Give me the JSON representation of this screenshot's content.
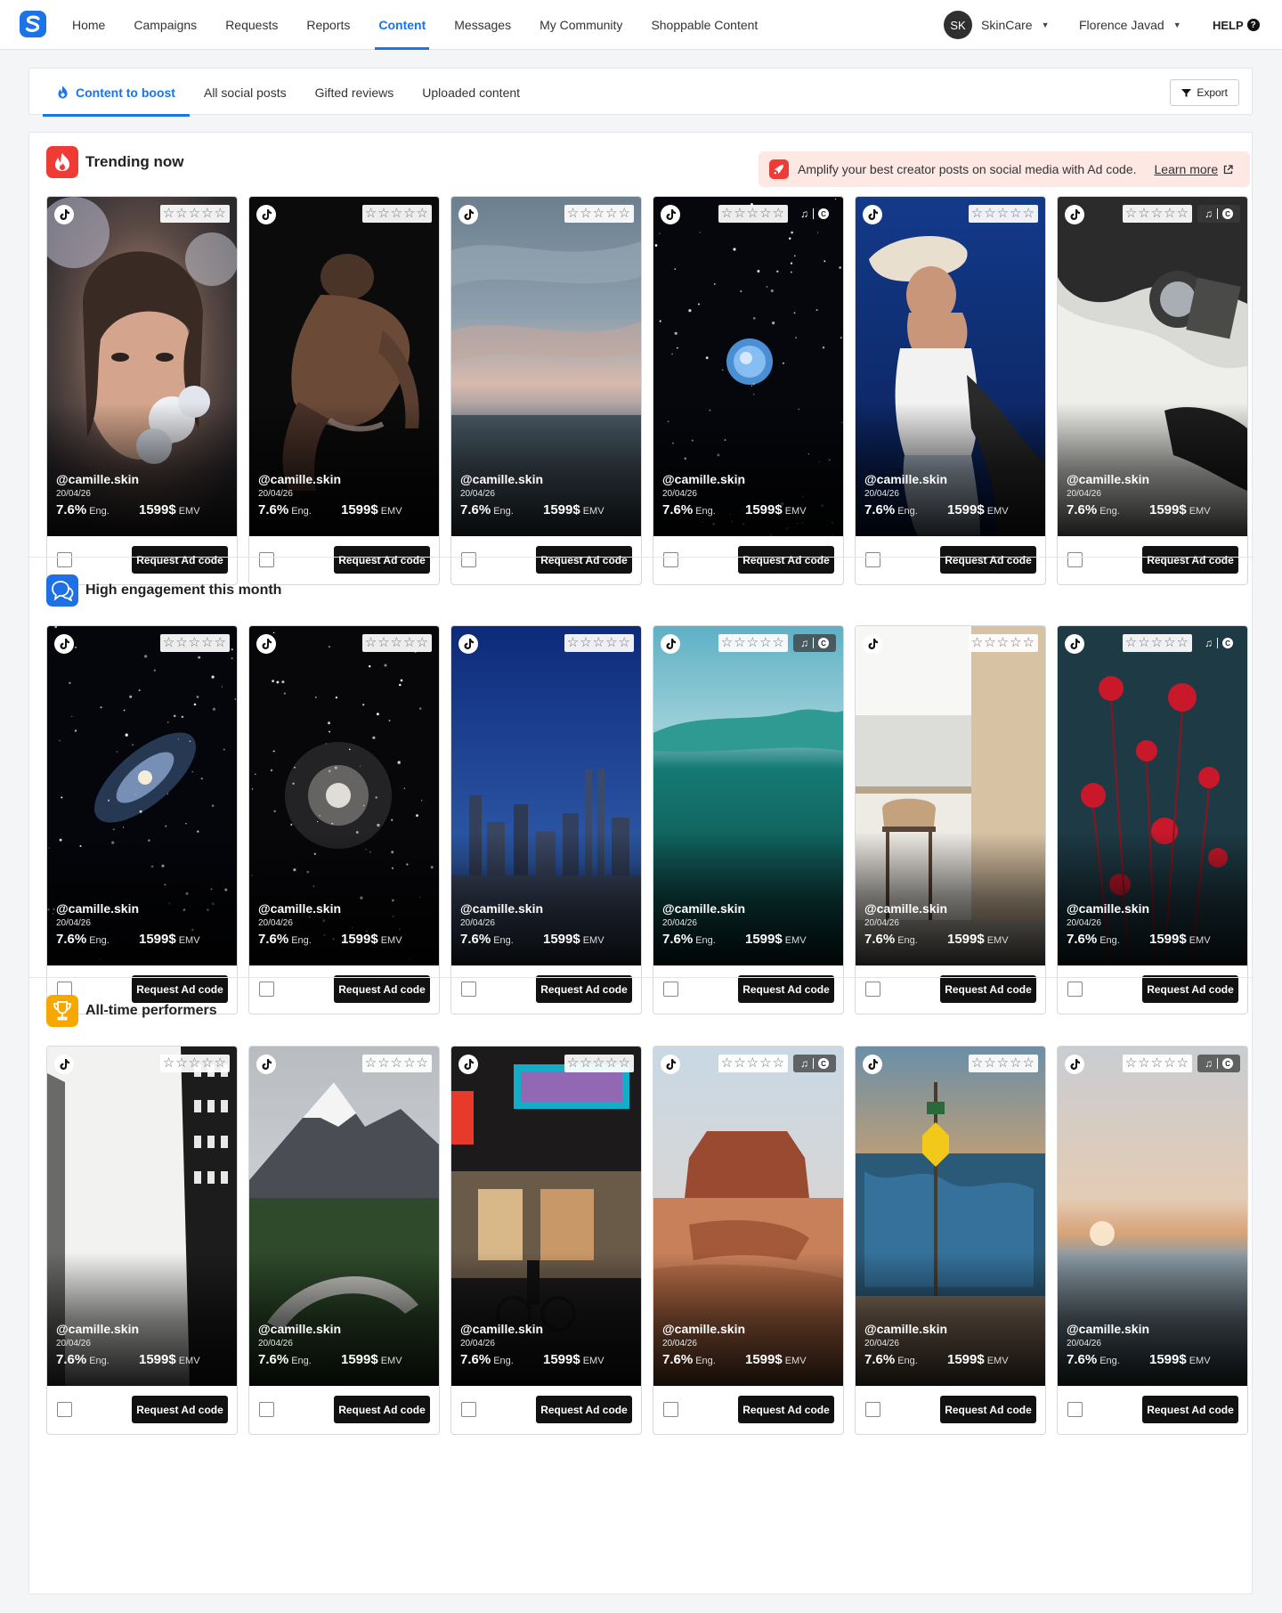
{
  "nav": {
    "links": [
      "Home",
      "Campaigns",
      "Requests",
      "Reports",
      "Content",
      "Messages",
      "My Community",
      "Shoppable Content"
    ],
    "active": 4,
    "account_initials": "SK",
    "account_name": "SkinCare",
    "user_name": "Florence Javad",
    "help_label": "HELP",
    "help_mark": "?"
  },
  "subtabs": {
    "items": [
      "Content to boost",
      "All social posts",
      "Gifted reviews",
      "Uploaded content"
    ],
    "active": 0,
    "export_label": "Export"
  },
  "banner": {
    "text": "Amplify your best creator posts on social media with Ad code.",
    "link": "Learn more"
  },
  "sections": [
    {
      "title": "Trending now",
      "icon": "flame-icon",
      "color": "#ef3b36",
      "cards": [
        {
          "handle": "@camille.skin",
          "date": "20/04/26",
          "eng": "7.6%",
          "emv": "1599$",
          "media": ""
        },
        {
          "handle": "@camille.skin",
          "date": "20/04/26",
          "eng": "7.6%",
          "emv": "1599$",
          "media": ""
        },
        {
          "handle": "@camille.skin",
          "date": "20/04/26",
          "eng": "7.6%",
          "emv": "1599$",
          "media": ""
        },
        {
          "handle": "@camille.skin",
          "date": "20/04/26",
          "eng": "7.6%",
          "emv": "1599$",
          "media": "plain"
        },
        {
          "handle": "@camille.skin",
          "date": "20/04/26",
          "eng": "7.6%",
          "emv": "1599$",
          "media": ""
        },
        {
          "handle": "@camille.skin",
          "date": "20/04/26",
          "eng": "7.6%",
          "emv": "1599$",
          "media": "dark"
        }
      ]
    },
    {
      "title": "High engagement this month",
      "icon": "chat-bubbles-icon",
      "color": "#1f6fe5",
      "cards": [
        {
          "handle": "@camille.skin",
          "date": "20/04/26",
          "eng": "7.6%",
          "emv": "1599$",
          "media": ""
        },
        {
          "handle": "@camille.skin",
          "date": "20/04/26",
          "eng": "7.6%",
          "emv": "1599$",
          "media": ""
        },
        {
          "handle": "@camille.skin",
          "date": "20/04/26",
          "eng": "7.6%",
          "emv": "1599$",
          "media": ""
        },
        {
          "handle": "@camille.skin",
          "date": "20/04/26",
          "eng": "7.6%",
          "emv": "1599$",
          "media": "dark"
        },
        {
          "handle": "@camille.skin",
          "date": "20/04/26",
          "eng": "7.6%",
          "emv": "1599$",
          "media": ""
        },
        {
          "handle": "@camille.skin",
          "date": "20/04/26",
          "eng": "7.6%",
          "emv": "1599$",
          "media": "plain"
        }
      ]
    },
    {
      "title": "All-time performers",
      "icon": "trophy-icon",
      "color": "#f6a800",
      "cards": [
        {
          "handle": "@camille.skin",
          "date": "20/04/26",
          "eng": "7.6%",
          "emv": "1599$",
          "media": ""
        },
        {
          "handle": "@camille.skin",
          "date": "20/04/26",
          "eng": "7.6%",
          "emv": "1599$",
          "media": ""
        },
        {
          "handle": "@camille.skin",
          "date": "20/04/26",
          "eng": "7.6%",
          "emv": "1599$",
          "media": ""
        },
        {
          "handle": "@camille.skin",
          "date": "20/04/26",
          "eng": "7.6%",
          "emv": "1599$",
          "media": "dark"
        },
        {
          "handle": "@camille.skin",
          "date": "20/04/26",
          "eng": "7.6%",
          "emv": "1599$",
          "media": ""
        },
        {
          "handle": "@camille.skin",
          "date": "20/04/26",
          "eng": "7.6%",
          "emv": "1599$",
          "media": "dark"
        }
      ]
    }
  ],
  "card_labels": {
    "eng_suffix": "Eng.",
    "emv_suffix": "EMV",
    "button": "Request Ad code",
    "stars": "☆☆☆☆☆",
    "c_mark": "C"
  },
  "colors": {
    "accent": "#1a73e8",
    "banner_bg": "#fde8e4",
    "button_bg": "#111111"
  }
}
